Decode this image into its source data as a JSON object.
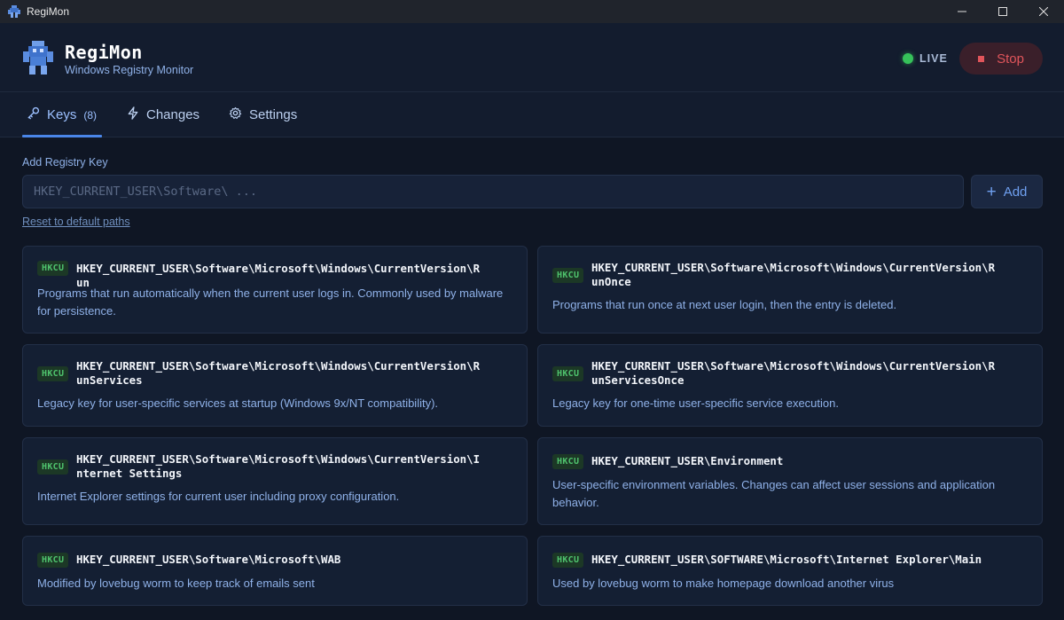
{
  "window": {
    "title": "RegiMon"
  },
  "header": {
    "app_name": "RegiMon",
    "subtitle": "Windows Registry Monitor",
    "status": "LIVE",
    "stop_label": "Stop",
    "colors": {
      "live": "#36c25a",
      "stop": "#e0555b"
    }
  },
  "tabs": [
    {
      "label": "Keys",
      "count": "(8)",
      "icon": "key-icon",
      "active": true
    },
    {
      "label": "Changes",
      "icon": "lightning-icon",
      "active": false
    },
    {
      "label": "Settings",
      "icon": "gear-icon",
      "active": false
    }
  ],
  "add_key": {
    "label": "Add Registry Key",
    "placeholder": "HKEY_CURRENT_USER\\Software\\ ...",
    "value": "",
    "button_label": "Add",
    "reset_link": "Reset to default paths"
  },
  "keys": [
    {
      "hive": "HKCU",
      "path": "HKEY_CURRENT_USER\\Software\\Microsoft\\Windows\\CurrentVersion\\Run",
      "description": "Programs that run automatically when the current user logs in. Commonly used by malware for persistence."
    },
    {
      "hive": "HKCU",
      "path": "HKEY_CURRENT_USER\\Software\\Microsoft\\Windows\\CurrentVersion\\RunOnce",
      "description": "Programs that run once at next user login, then the entry is deleted."
    },
    {
      "hive": "HKCU",
      "path": "HKEY_CURRENT_USER\\Software\\Microsoft\\Windows\\CurrentVersion\\RunServices",
      "description": "Legacy key for user-specific services at startup (Windows 9x/NT compatibility)."
    },
    {
      "hive": "HKCU",
      "path": "HKEY_CURRENT_USER\\Software\\Microsoft\\Windows\\CurrentVersion\\RunServicesOnce",
      "description": "Legacy key for one-time user-specific service execution."
    },
    {
      "hive": "HKCU",
      "path": "HKEY_CURRENT_USER\\Software\\Microsoft\\Windows\\CurrentVersion\\Internet Settings",
      "description": "Internet Explorer settings for current user including proxy configuration."
    },
    {
      "hive": "HKCU",
      "path": "HKEY_CURRENT_USER\\Environment",
      "description": "User-specific environment variables. Changes can affect user sessions and application behavior."
    },
    {
      "hive": "HKCU",
      "path": "HKEY_CURRENT_USER\\Software\\Microsoft\\WAB",
      "description": "Modified by lovebug worm to keep track of emails sent"
    },
    {
      "hive": "HKCU",
      "path": "HKEY_CURRENT_USER\\SOFTWARE\\Microsoft\\Internet Explorer\\Main",
      "description": "Used by lovebug worm to make homepage download another virus"
    }
  ]
}
